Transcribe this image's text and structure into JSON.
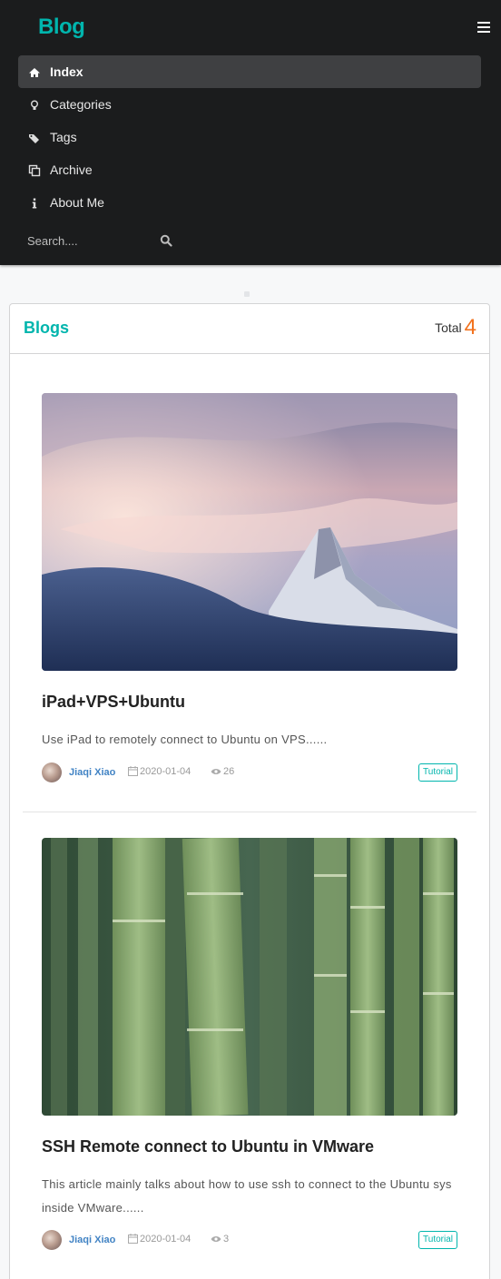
{
  "nav": {
    "brand": "Blog",
    "items": [
      {
        "label": "Index",
        "icon": "home-icon",
        "active": true
      },
      {
        "label": "Categories",
        "icon": "lightbulb-icon"
      },
      {
        "label": "Tags",
        "icon": "tags-icon"
      },
      {
        "label": "Archive",
        "icon": "clone-icon"
      },
      {
        "label": "About Me",
        "icon": "info-icon"
      }
    ],
    "search_placeholder": "Search...."
  },
  "blogs": {
    "title": "Blogs",
    "total_label": "Total",
    "total": "4",
    "posts": [
      {
        "title": "iPad+VPS+Ubuntu",
        "excerpt": "Use iPad to remotely connect to Ubuntu on VPS......",
        "author": "Jiaqi Xiao",
        "date": "2020-01-04",
        "views": "26",
        "tag": "Tutorial",
        "image": "mountain-sunset-image"
      },
      {
        "title": "SSH Remote connect to Ubuntu in VMware",
        "excerpt": "This article mainly talks about how to use ssh to connect to the Ubuntu sys inside VMware......",
        "author": "Jiaqi Xiao",
        "date": "2020-01-04",
        "views": "3",
        "tag": "Tutorial",
        "image": "bamboo-forest-image"
      }
    ]
  },
  "colors": {
    "brand": "#00b5ad",
    "navbar_bg": "#1b1c1d",
    "total_number": "#f2711c",
    "author_link": "#4183c4"
  }
}
